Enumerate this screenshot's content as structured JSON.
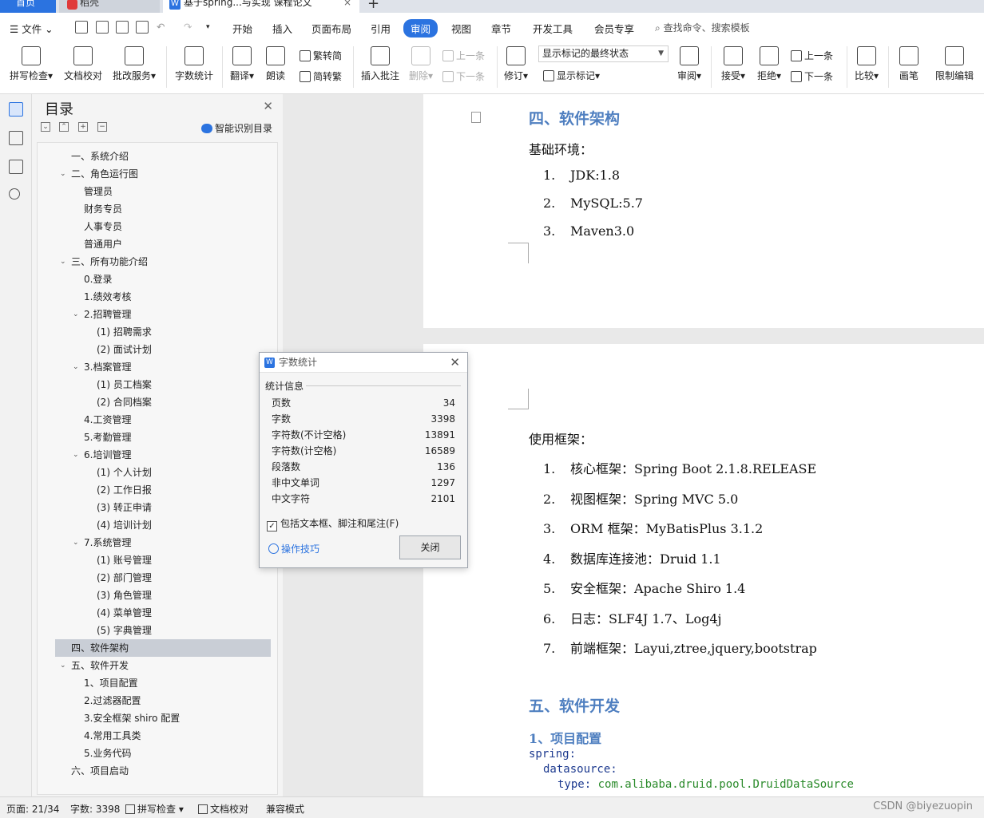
{
  "tabs": {
    "home": "首页",
    "docer": "稻壳",
    "doc": "基于spring...与实现 课程论文",
    "close_icon": "×",
    "new_tab": "+"
  },
  "menu": {
    "file": "文件",
    "items": [
      "开始",
      "插入",
      "页面布局",
      "引用",
      "审阅",
      "视图",
      "章节",
      "开发工具",
      "会员专享"
    ],
    "active_index": 4,
    "search": "查找命令、搜索模板"
  },
  "ribbon": {
    "spellcheck": "拼写检查",
    "doc_proof": "文档校对",
    "batch_service": "批改服务",
    "word_count": "字数统计",
    "translate": "翻译",
    "read_aloud": "朗读",
    "to_traditional": "简转繁",
    "to_simplified": "繁转简",
    "insert_comment": "插入批注",
    "delete": "删除",
    "prev_comment": "上一条",
    "next_comment": "下一条",
    "track_changes": "修订",
    "markup_state": "显示标记的最终状态",
    "show_markup": "显示标记",
    "review": "审阅",
    "accept": "接受",
    "reject": "拒绝",
    "prev_change": "上一条",
    "next_change": "下一条",
    "compare": "比较",
    "pen": "画笔",
    "restrict_edit": "限制编辑"
  },
  "toc": {
    "title": "目录",
    "smart": "智能识别目录",
    "items": [
      {
        "text": "一、系统介绍",
        "level": 1,
        "chev": ""
      },
      {
        "text": "二、角色运行图",
        "level": 1,
        "chev": "v"
      },
      {
        "text": "管理员",
        "level": 2,
        "chev": ""
      },
      {
        "text": "财务专员",
        "level": 2,
        "chev": ""
      },
      {
        "text": "人事专员",
        "level": 2,
        "chev": ""
      },
      {
        "text": "普通用户",
        "level": 2,
        "chev": ""
      },
      {
        "text": "三、所有功能介绍",
        "level": 1,
        "chev": "v"
      },
      {
        "text": "0.登录",
        "level": 2,
        "chev": ""
      },
      {
        "text": "1.绩效考核",
        "level": 2,
        "chev": ""
      },
      {
        "text": "2.招聘管理",
        "level": 2,
        "chev": "v"
      },
      {
        "text": "(1) 招聘需求",
        "level": 3,
        "chev": ""
      },
      {
        "text": "(2) 面试计划",
        "level": 3,
        "chev": ""
      },
      {
        "text": "3.档案管理",
        "level": 2,
        "chev": "v"
      },
      {
        "text": "(1) 员工档案",
        "level": 3,
        "chev": ""
      },
      {
        "text": "(2) 合同档案",
        "level": 3,
        "chev": ""
      },
      {
        "text": "4.工资管理",
        "level": 2,
        "chev": ""
      },
      {
        "text": "5.考勤管理",
        "level": 2,
        "chev": ""
      },
      {
        "text": "6.培训管理",
        "level": 2,
        "chev": "v"
      },
      {
        "text": "(1) 个人计划",
        "level": 3,
        "chev": ""
      },
      {
        "text": "(2) 工作日报",
        "level": 3,
        "chev": ""
      },
      {
        "text": "(3) 转正申请",
        "level": 3,
        "chev": ""
      },
      {
        "text": "(4) 培训计划",
        "level": 3,
        "chev": ""
      },
      {
        "text": "7.系统管理",
        "level": 2,
        "chev": "v"
      },
      {
        "text": "(1) 账号管理",
        "level": 3,
        "chev": ""
      },
      {
        "text": "(2) 部门管理",
        "level": 3,
        "chev": ""
      },
      {
        "text": "(3) 角色管理",
        "level": 3,
        "chev": ""
      },
      {
        "text": "(4) 菜单管理",
        "level": 3,
        "chev": ""
      },
      {
        "text": "(5) 字典管理",
        "level": 3,
        "chev": ""
      },
      {
        "text": "四、软件架构",
        "level": 1,
        "chev": "",
        "selected": true
      },
      {
        "text": "五、软件开发",
        "level": 1,
        "chev": "v"
      },
      {
        "text": "1、项目配置",
        "level": 2,
        "chev": ""
      },
      {
        "text": "2.过滤器配置",
        "level": 2,
        "chev": ""
      },
      {
        "text": "3.安全框架 shiro 配置",
        "level": 2,
        "chev": ""
      },
      {
        "text": "4.常用工具类",
        "level": 2,
        "chev": ""
      },
      {
        "text": "5.业务代码",
        "level": 2,
        "chev": ""
      },
      {
        "text": "六、项目启动",
        "level": 1,
        "chev": ""
      }
    ]
  },
  "doc": {
    "h_arch": "四、软件架构",
    "base_env": "基础环境：",
    "env_list": [
      {
        "num": "1.",
        "text": "JDK:1.8"
      },
      {
        "num": "2.",
        "text": "MySQL:5.7"
      },
      {
        "num": "3.",
        "text": "Maven3.0"
      }
    ],
    "frameworks": "使用框架：",
    "fw_list": [
      {
        "num": "1.",
        "text": "核心框架：Spring Boot 2.1.8.RELEASE"
      },
      {
        "num": "2.",
        "text": "视图框架：Spring MVC 5.0"
      },
      {
        "num": "3.",
        "text": "ORM 框架：MyBatisPlus 3.1.2"
      },
      {
        "num": "4.",
        "text": "数据库连接池：Druid 1.1"
      },
      {
        "num": "5.",
        "text": "安全框架：Apache Shiro 1.4"
      },
      {
        "num": "6.",
        "text": "日志：SLF4J 1.7、Log4j"
      },
      {
        "num": "7.",
        "text": "前端框架：Layui,ztree,jquery,bootstrap"
      }
    ],
    "h_dev": "五、软件开发",
    "h_config": "1、项目配置",
    "code1": "spring:",
    "code2": "datasource:",
    "code3_key": "type:",
    "code3_val": "com.alibaba.druid.pool.DruidDataSource"
  },
  "dialog": {
    "title": "字数统计",
    "section": "统计信息",
    "rows": [
      {
        "label": "页数",
        "value": "34"
      },
      {
        "label": "字数",
        "value": "3398"
      },
      {
        "label": "字符数(不计空格)",
        "value": "13891"
      },
      {
        "label": "字符数(计空格)",
        "value": "16589"
      },
      {
        "label": "段落数",
        "value": "136"
      },
      {
        "label": "非中文单词",
        "value": "1297"
      },
      {
        "label": "中文字符",
        "value": "2101"
      }
    ],
    "include_label": "包括文本框、脚注和尾注(F)",
    "include_checked": true,
    "tips": "操作技巧",
    "close_button": "关闭"
  },
  "status": {
    "page": "页面: 21/34",
    "words": "字数: 3398",
    "spell": "拼写检查",
    "proof": "文档校对",
    "compat": "兼容模式",
    "watermark": "CSDN @biyezuopin"
  },
  "colors": {
    "accent": "#2b73e0",
    "heading": "#4f7fc0"
  }
}
